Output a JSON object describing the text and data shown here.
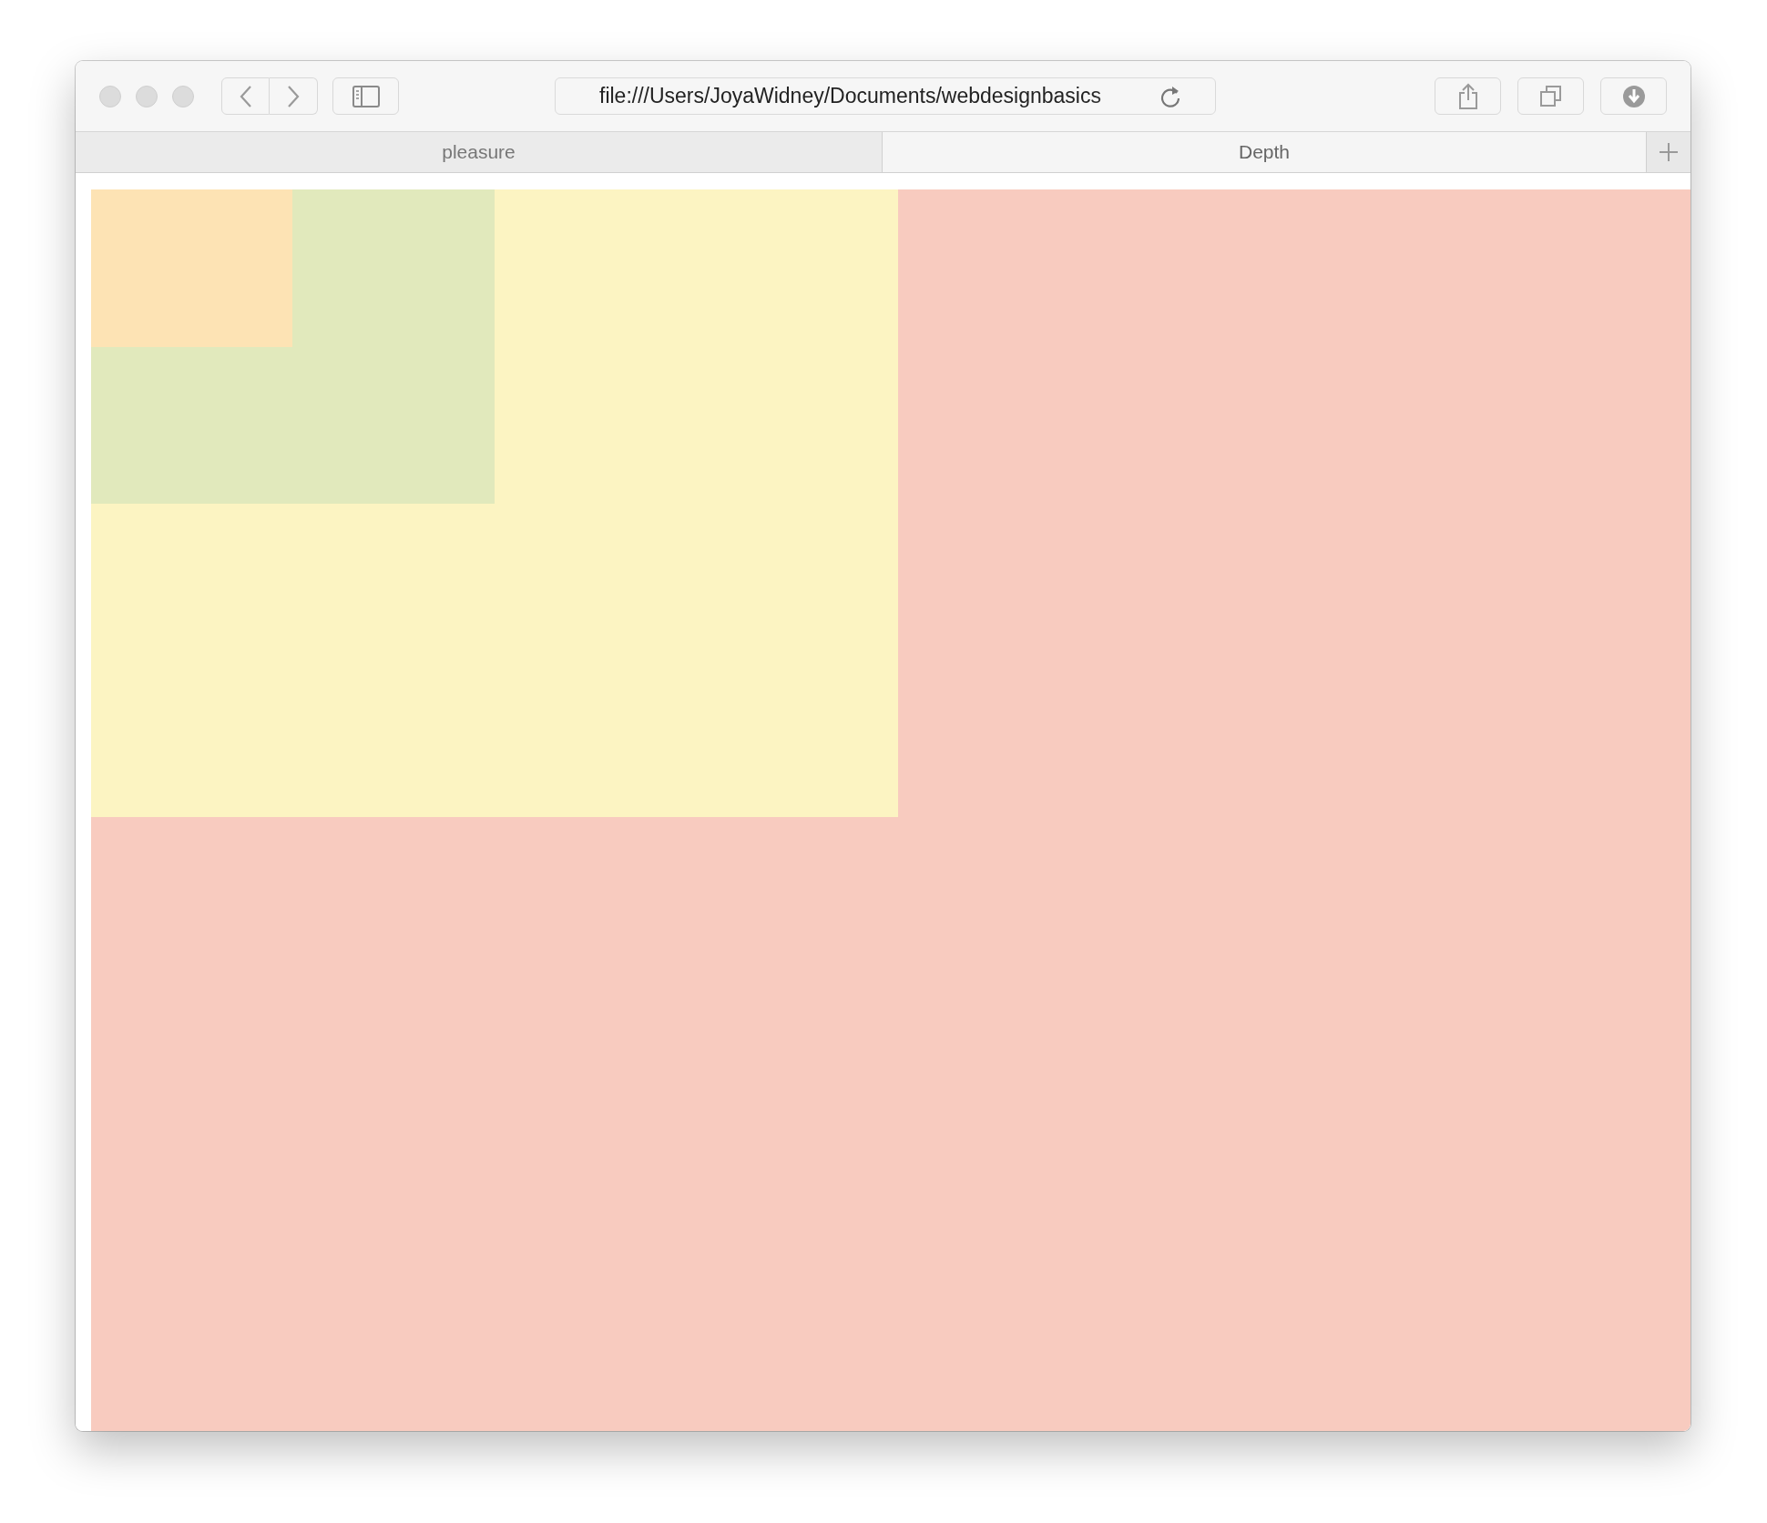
{
  "toolbar": {
    "url": "file:///Users/JoyaWidney/Documents/webdesignbasics"
  },
  "tabs": [
    {
      "label": "pleasure",
      "selected": false
    },
    {
      "label": "Depth",
      "selected": true
    }
  ],
  "page": {
    "boxes": [
      {
        "color": "#f8cbbf",
        "children": [
          {
            "color": "#fcf4c2",
            "children": [
              {
                "color": "#e1e9bc",
                "children": [
                  {
                    "color": "#fde3b4"
                  }
                ]
              }
            ]
          }
        ]
      }
    ]
  }
}
